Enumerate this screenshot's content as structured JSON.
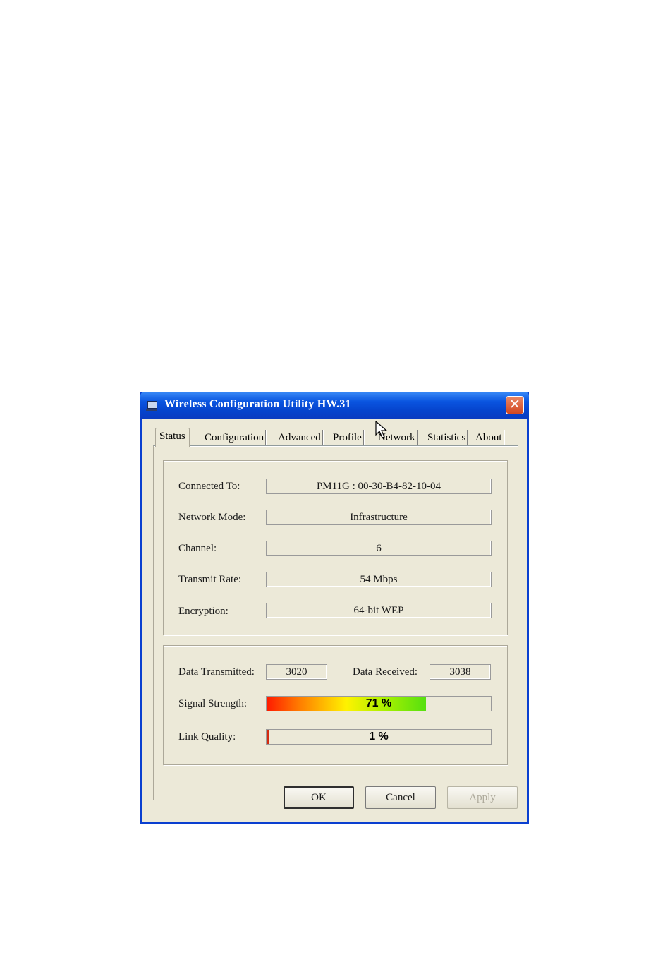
{
  "window": {
    "title": "Wireless Configuration Utility HW.31",
    "title_icon": "computer-icon",
    "close_icon": "close-icon",
    "close_glyph": "✕"
  },
  "tabs": [
    {
      "label": "Status",
      "active": true
    },
    {
      "label": "Configuration"
    },
    {
      "label": "Advanced"
    },
    {
      "label": "Profile"
    },
    {
      "label": "Network"
    },
    {
      "label": "Statistics"
    },
    {
      "label": "About"
    }
  ],
  "status": {
    "connected_to": {
      "label": "Connected To:",
      "value": "PM11G : 00-30-B4-82-10-04"
    },
    "network_mode": {
      "label": "Network Mode:",
      "value": "Infrastructure"
    },
    "channel": {
      "label": "Channel:",
      "value": "6"
    },
    "transmit_rate": {
      "label": "Transmit Rate:",
      "value": "54 Mbps"
    },
    "encryption": {
      "label": "Encryption:",
      "value": "64-bit WEP"
    }
  },
  "stats": {
    "data_transmitted": {
      "label": "Data Transmitted:",
      "value": "3020"
    },
    "data_received": {
      "label": "Data Received:",
      "value": "3038"
    },
    "signal_strength": {
      "label": "Signal Strength:",
      "value_text": "71 %",
      "percent": 71
    },
    "link_quality": {
      "label": "Link Quality:",
      "value_text": "1 %",
      "percent": 1
    }
  },
  "buttons": {
    "ok": "OK",
    "cancel": "Cancel",
    "apply": "Apply"
  },
  "colors": {
    "titlebar": "#0a55e0",
    "dialog_bg": "#ece9d8",
    "link_quality_fill": "#d42a10"
  }
}
